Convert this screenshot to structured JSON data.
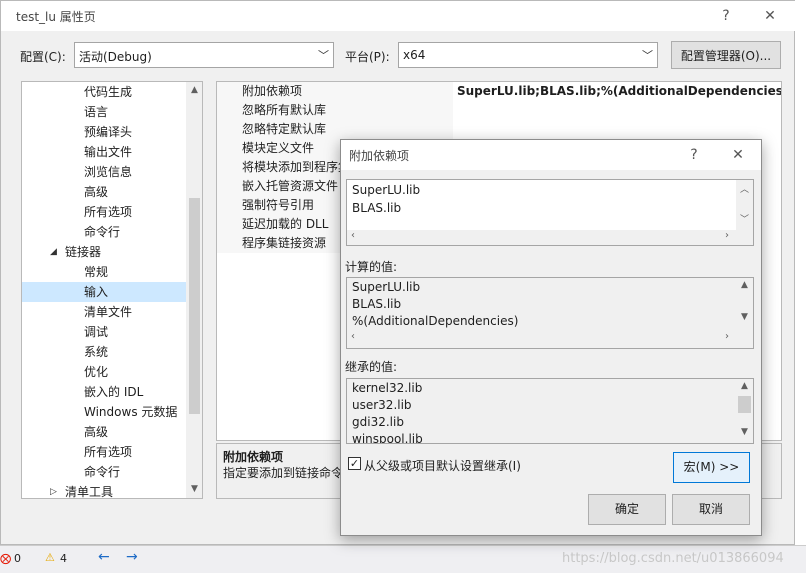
{
  "window": {
    "title": "test_lu 属性页",
    "help_glyph": "?",
    "close_glyph": "✕"
  },
  "toolbar": {
    "config_label": "配置(C):",
    "config_value": "活动(Debug)",
    "platform_label": "平台(P):",
    "platform_value": "x64",
    "config_manager_label": "配置管理器(O)..."
  },
  "tree": {
    "items": [
      {
        "label": "代码生成"
      },
      {
        "label": "语言"
      },
      {
        "label": "预编译头"
      },
      {
        "label": "输出文件"
      },
      {
        "label": "浏览信息"
      },
      {
        "label": "高级"
      },
      {
        "label": "所有选项"
      },
      {
        "label": "命令行"
      },
      {
        "label": "链接器",
        "expander": "◢"
      },
      {
        "label": "常规"
      },
      {
        "label": "输入",
        "selected": true
      },
      {
        "label": "清单文件"
      },
      {
        "label": "调试"
      },
      {
        "label": "系统"
      },
      {
        "label": "优化"
      },
      {
        "label": "嵌入的 IDL"
      },
      {
        "label": "Windows 元数据"
      },
      {
        "label": "高级"
      },
      {
        "label": "所有选项"
      },
      {
        "label": "命令行"
      },
      {
        "label": "清单工具",
        "expander": "▷"
      }
    ]
  },
  "grid": {
    "rows": [
      {
        "name": "附加依赖项",
        "value": "SuperLU.lib;BLAS.lib;%(AdditionalDependencies)"
      },
      {
        "name": "忽略所有默认库",
        "value": ""
      },
      {
        "name": "忽略特定默认库",
        "value": ""
      },
      {
        "name": "模块定义文件",
        "value": ""
      },
      {
        "name": "将模块添加到程序集",
        "value": ""
      },
      {
        "name": "嵌入托管资源文件",
        "value": ""
      },
      {
        "name": "强制符号引用",
        "value": ""
      },
      {
        "name": "延迟加载的 DLL",
        "value": ""
      },
      {
        "name": "程序集链接资源",
        "value": ""
      }
    ],
    "desc_title": "附加依赖项",
    "desc_text": "指定要添加到链接命令"
  },
  "dialog": {
    "title": "附加依赖项",
    "help_glyph": "?",
    "close_glyph": "✕",
    "edit_lines": [
      "SuperLU.lib",
      "BLAS.lib"
    ],
    "evaluated_label": "计算的值:",
    "evaluated_lines": [
      "SuperLU.lib",
      "BLAS.lib",
      "%(AdditionalDependencies)"
    ],
    "inherited_label": "继承的值:",
    "inherited_lines": [
      "kernel32.lib",
      "user32.lib",
      "gdi32.lib",
      "winspool.lib"
    ],
    "inherit_checkbox_label": "从父级或项目默认设置继承(I)",
    "inherit_checked": true,
    "check_glyph": "✓",
    "macro_button": "宏(M) >>",
    "ok_button": "确定",
    "cancel_button": "取消"
  },
  "status": {
    "error_count": "0",
    "warning_count": "4",
    "back_arrow": "←",
    "forward_arrow": "→"
  },
  "watermark": "https://blog.csdn.net/u013866094"
}
